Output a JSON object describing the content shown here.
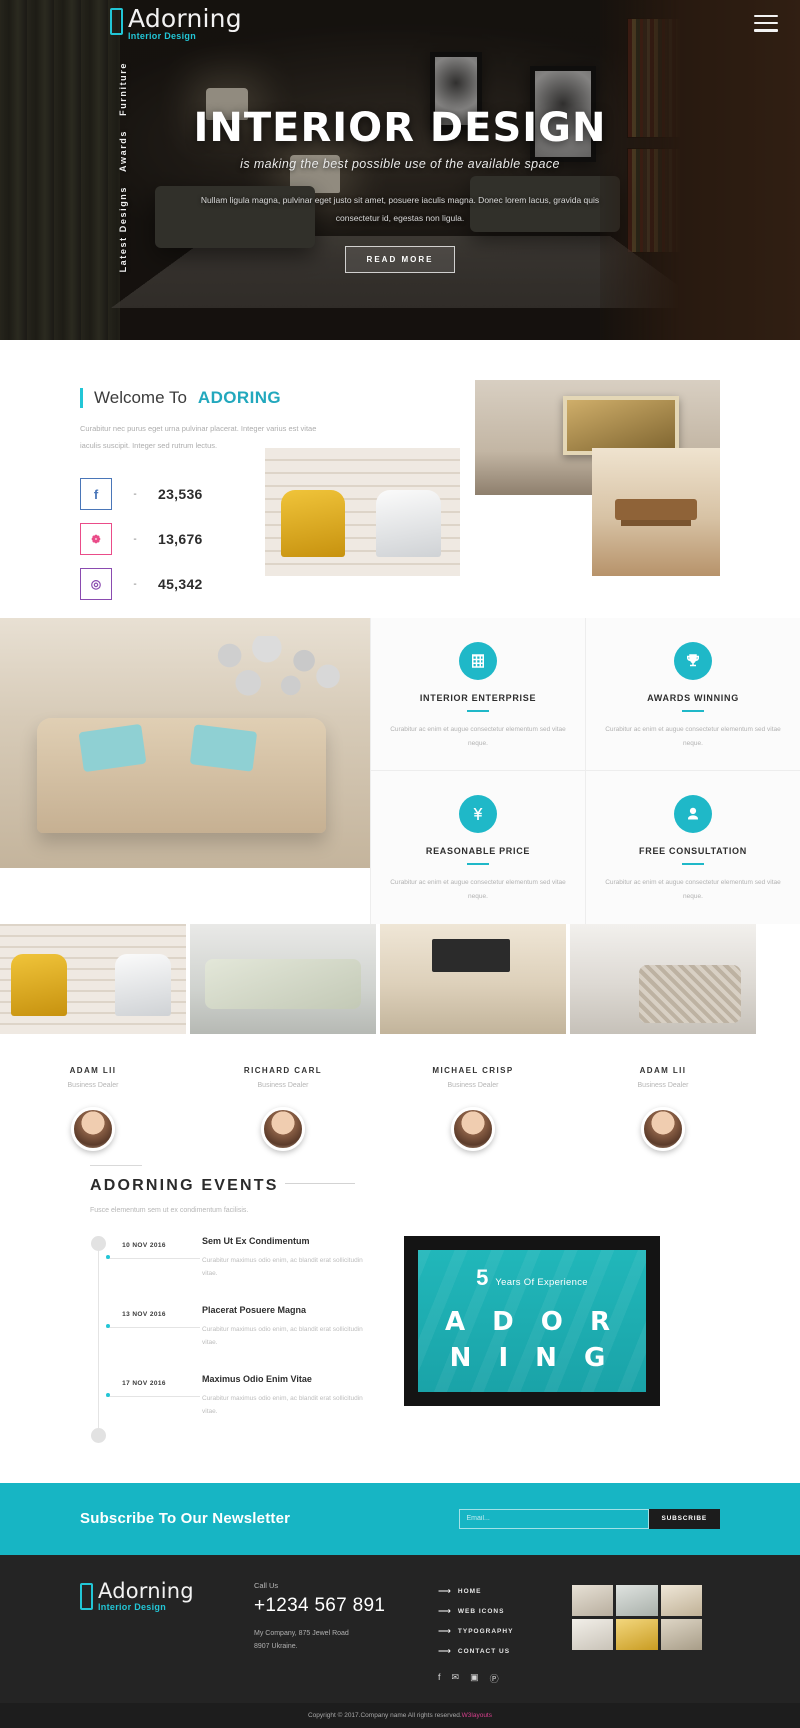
{
  "brand": {
    "name": "Adorning",
    "tagline": "Interior Design"
  },
  "sidenav": {
    "items": [
      {
        "label": "Latest Designs"
      },
      {
        "label": "Awards"
      },
      {
        "label": "Furniture"
      }
    ]
  },
  "hero": {
    "title": "INTERIOR DESIGN",
    "subtitle": "is making the best possible use of the available space",
    "paragraph": "Nullam ligula magna, pulvinar eget justo sit amet, posuere iaculis magna. Donec lorem lacus, gravida quis consectetur id, egestas non ligula.",
    "button": "READ MORE"
  },
  "welcome": {
    "title_prefix": "Welcome To",
    "title_brand": "ADORING",
    "paragraph": "Curabitur nec purus eget urna pulvinar placerat. Integer varius est vitae iaculis suscipit. Integer sed rutrum lectus.",
    "stats": [
      {
        "icon": "facebook-icon",
        "glyph": "f",
        "dash": "-",
        "count": "23,536",
        "color": "#4a76b8"
      },
      {
        "icon": "dribbble-icon",
        "glyph": "❁",
        "dash": "-",
        "count": "13,676",
        "color": "#ea4c89"
      },
      {
        "icon": "instagram-icon",
        "glyph": "◎",
        "dash": "-",
        "count": "45,342",
        "color": "#8a4bb0"
      }
    ]
  },
  "features": [
    {
      "icon": "building-grid-icon",
      "title": "INTERIOR ENTERPRISE",
      "text": "Curabitur ac enim et augue consectetur elementum sed vitae neque."
    },
    {
      "icon": "trophy-icon",
      "title": "AWARDS WINNING",
      "text": "Curabitur ac enim et augue consectetur elementum sed vitae neque."
    },
    {
      "icon": "yen-currency-icon",
      "title": "REASONABLE PRICE",
      "text": "Curabitur ac enim et augue consectetur elementum sed vitae neque."
    },
    {
      "icon": "user-icon",
      "title": "FREE CONSULTATION",
      "text": "Curabitur ac enim et augue consectetur elementum sed vitae neque."
    }
  ],
  "team": [
    {
      "name": "ADAM LII",
      "role": "Business Dealer"
    },
    {
      "name": "RICHARD CARL",
      "role": "Business Dealer"
    },
    {
      "name": "MICHAEL CRISP",
      "role": "Business Dealer"
    },
    {
      "name": "ADAM LII",
      "role": "Business Dealer"
    }
  ],
  "events": {
    "title": "ADORNING EVENTS",
    "subtitle": "Fusce elementum sem ut ex condimentum facilisis.",
    "items": [
      {
        "date": "10 NOV 2016",
        "title": "Sem Ut Ex Condimentum",
        "text": "Curabitur maximus odio enim, ac blandit erat sollicitudin vitae."
      },
      {
        "date": "13 NOV 2016",
        "title": "Placerat Posuere Magna",
        "text": "Curabitur maximus odio enim, ac blandit erat sollicitudin vitae."
      },
      {
        "date": "17 NOV 2016",
        "title": "Maximus Odio Enim Vitae",
        "text": "Curabitur maximus odio enim, ac blandit erat sollicitudin vitae."
      }
    ],
    "experience": {
      "number": "5",
      "label": "Years Of Experience",
      "brand_line1": "A D O R",
      "brand_line2": "N I N G"
    }
  },
  "newsletter": {
    "heading": "Subscribe To Our Newsletter",
    "placeholder": "Email...",
    "value": "",
    "button": "SUBSCRIBE"
  },
  "footer": {
    "call_label": "Call Us",
    "phone": "+1234 567 891",
    "address_line1": "My Company, 875 Jewel Road",
    "address_line2": "8907 Ukraine.",
    "links": [
      {
        "label": "HOME"
      },
      {
        "label": "WEB ICONS"
      },
      {
        "label": "TYPOGRAPHY"
      },
      {
        "label": "CONTACT US"
      }
    ],
    "social": [
      {
        "icon": "facebook-icon",
        "glyph": "f"
      },
      {
        "icon": "twitter-icon",
        "glyph": "✉"
      },
      {
        "icon": "instagram-icon",
        "glyph": "▣"
      },
      {
        "icon": "pinterest-icon",
        "glyph": "Ⓟ"
      }
    ]
  },
  "copyright": {
    "text": "Copyright © 2017.Company name All rights reserved.",
    "credit_1": "W3layouts",
    "credit_2": ""
  },
  "colors": {
    "accent": "#22c6d6",
    "teal": "#17b5c4",
    "dark": "#242424"
  }
}
